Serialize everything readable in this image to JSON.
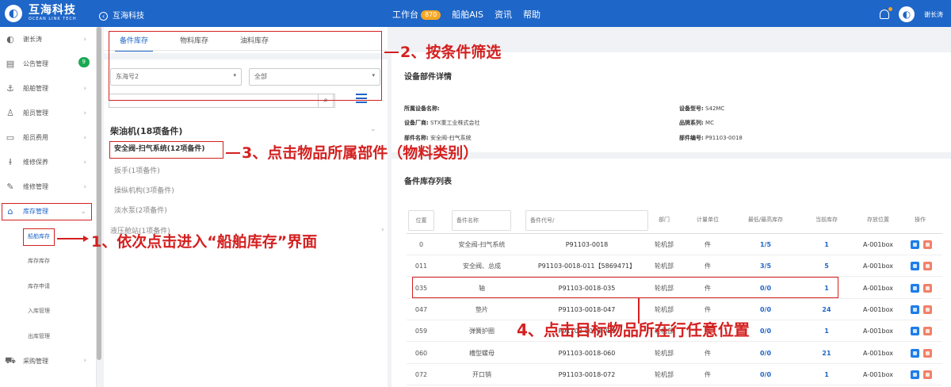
{
  "app": {
    "name": "互海科技",
    "sub": "OCEAN LINK TECH",
    "breadcrumb": "互海科技",
    "user": "谢长涛"
  },
  "nav": {
    "items": [
      "工作台",
      "船舶AIS",
      "资讯",
      "帮助"
    ],
    "workbench_badge": "870"
  },
  "sidebar": {
    "items": [
      {
        "label": "谢长涛",
        "icon": "logo-icon"
      },
      {
        "label": "公告管理",
        "icon": "notice-icon",
        "badge": "9"
      },
      {
        "label": "船舶管理",
        "icon": "anchor-icon"
      },
      {
        "label": "船员管理",
        "icon": "crew-icon"
      },
      {
        "label": "船员费用",
        "icon": "wallet-icon"
      },
      {
        "label": "维修保养",
        "icon": "wrench-icon"
      },
      {
        "label": "维修管理",
        "icon": "tool-icon"
      },
      {
        "label": "库存管理",
        "icon": "warehouse-icon"
      }
    ],
    "sub_items": [
      "船舶库存",
      "库存库存",
      "库存申请",
      "入库管理",
      "出库管理"
    ],
    "bottom": [
      {
        "label": "采购管理",
        "icon": "cart-icon"
      },
      {
        "label": "业务管理",
        "icon": "biz-icon"
      }
    ]
  },
  "left": {
    "tabs": [
      "备件库存",
      "物料库存",
      "油料库存"
    ],
    "ship_select": "东海号2",
    "dept_select": "全部",
    "tree": {
      "root": "柴油机(18项备件)",
      "selected": "安全阀-扫气系统(12项备件)",
      "items": [
        "扳手(1项备件)",
        "操纵机构(3项备件)",
        "淡水泵(2项备件)",
        "液压舱站(1项备件)"
      ]
    }
  },
  "details": {
    "title": "设备部件详情",
    "equip_name_label": "所属设备名称:",
    "equip_name": "",
    "maker_label": "设备厂商:",
    "maker": "STX重工业株式会社",
    "part_label": "部件名称:",
    "part": "安全阀-扫气系统",
    "model_label": "设备型号:",
    "model": "S42MC",
    "brand_label": "品牌系列:",
    "brand": "MC",
    "partno_label": "部件编号:",
    "partno": "P91103-0018"
  },
  "table": {
    "title": "备件库存列表",
    "headers": [
      "位置",
      "备件名称",
      "备件代号/",
      "部门",
      "计量单位",
      "最低/最高库存",
      "当前库存",
      "存放位置",
      "操作"
    ],
    "rows": [
      {
        "pos": "0",
        "name": "安全阀-扫气系统",
        "code": "P91103-0018",
        "dept": "轮机部",
        "unit": "件",
        "minmax": "1/5",
        "cur": "1",
        "loc": "A-001box"
      },
      {
        "pos": "011",
        "name": "安全阀、总成",
        "code": "P91103-0018-011【5869471】",
        "dept": "轮机部",
        "unit": "件",
        "minmax": "3/5",
        "cur": "5",
        "loc": "A-001box"
      },
      {
        "pos": "035",
        "name": "轴",
        "code": "P91103-0018-035",
        "dept": "轮机部",
        "unit": "件",
        "minmax": "0/0",
        "cur": "1",
        "loc": "A-001box"
      },
      {
        "pos": "047",
        "name": "垫片",
        "code": "P91103-0018-047",
        "dept": "轮机部",
        "unit": "件",
        "minmax": "0/0",
        "cur": "24",
        "loc": "A-001box"
      },
      {
        "pos": "059",
        "name": "弹簧护圈",
        "code": "P91103-0018-059",
        "dept": "轮机部",
        "unit": "件",
        "minmax": "0/0",
        "cur": "1",
        "loc": "A-001box"
      },
      {
        "pos": "060",
        "name": "槽型螺母",
        "code": "P91103-0018-060",
        "dept": "轮机部",
        "unit": "件",
        "minmax": "0/0",
        "cur": "21",
        "loc": "A-001box"
      },
      {
        "pos": "072",
        "name": "开口销",
        "code": "P91103-0018-072",
        "dept": "轮机部",
        "unit": "件",
        "minmax": "0/0",
        "cur": "1",
        "loc": "A-001box"
      }
    ]
  },
  "annotations": {
    "a1": "1、依次点击进入“船舶库存”界面",
    "a2": "2、按条件筛选",
    "a3": "3、点击物品所属部件（物料类别）",
    "a4": "4、点击目标物品所在行任意位置"
  },
  "colors": {
    "primary": "#1e66c8",
    "annotation": "#d42020",
    "badge": "#f5a623"
  }
}
